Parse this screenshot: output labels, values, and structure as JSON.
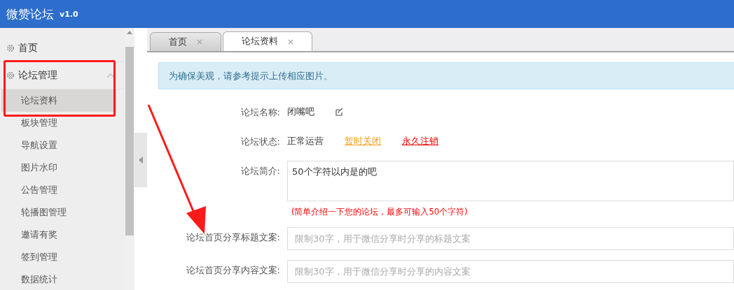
{
  "header": {
    "title": "微赞论坛",
    "version": "v1.0"
  },
  "sidebar": {
    "items": [
      {
        "label": "首页",
        "expanded": false
      },
      {
        "label": "论坛管理",
        "expanded": true,
        "children": [
          {
            "label": "论坛资料",
            "selected": true
          },
          {
            "label": "板块管理",
            "selected": false
          },
          {
            "label": "导航设置",
            "selected": false
          },
          {
            "label": "图片水印",
            "selected": false
          },
          {
            "label": "公告管理",
            "selected": false
          },
          {
            "label": "轮播图管理",
            "selected": false
          },
          {
            "label": "邀请有奖",
            "selected": false
          },
          {
            "label": "签到管理",
            "selected": false
          },
          {
            "label": "数据统计",
            "selected": false
          }
        ]
      }
    ]
  },
  "tabs": [
    {
      "label": "首页",
      "selected": false
    },
    {
      "label": "论坛资料",
      "selected": true
    }
  ],
  "notice": "为确保美观，请参考提示上传相应图片。",
  "form": [
    {
      "kind": "text",
      "label": "论坛名称:",
      "value": "闭嘴吧"
    },
    {
      "kind": "status",
      "label": "论坛状态:",
      "value": "正常运营",
      "links": [
        {
          "label": "暂时关闭",
          "color": "#f39c12"
        },
        {
          "label": "永久注销",
          "color": "#ff0000"
        }
      ]
    },
    {
      "kind": "textarea",
      "label": "论坛简介:",
      "value": "50个字符以内是的吧",
      "hint": "(简单介绍一下您的论坛，最多可输入50个字符)"
    },
    {
      "kind": "input",
      "label": "论坛首页分享标题文案:",
      "placeholder": "限制30字，用于微信分享时分享的标题文案"
    },
    {
      "kind": "input",
      "label": "论坛首页分享内容文案:",
      "placeholder": "限制30字，用于微信分享时分享的内容文案"
    }
  ]
}
